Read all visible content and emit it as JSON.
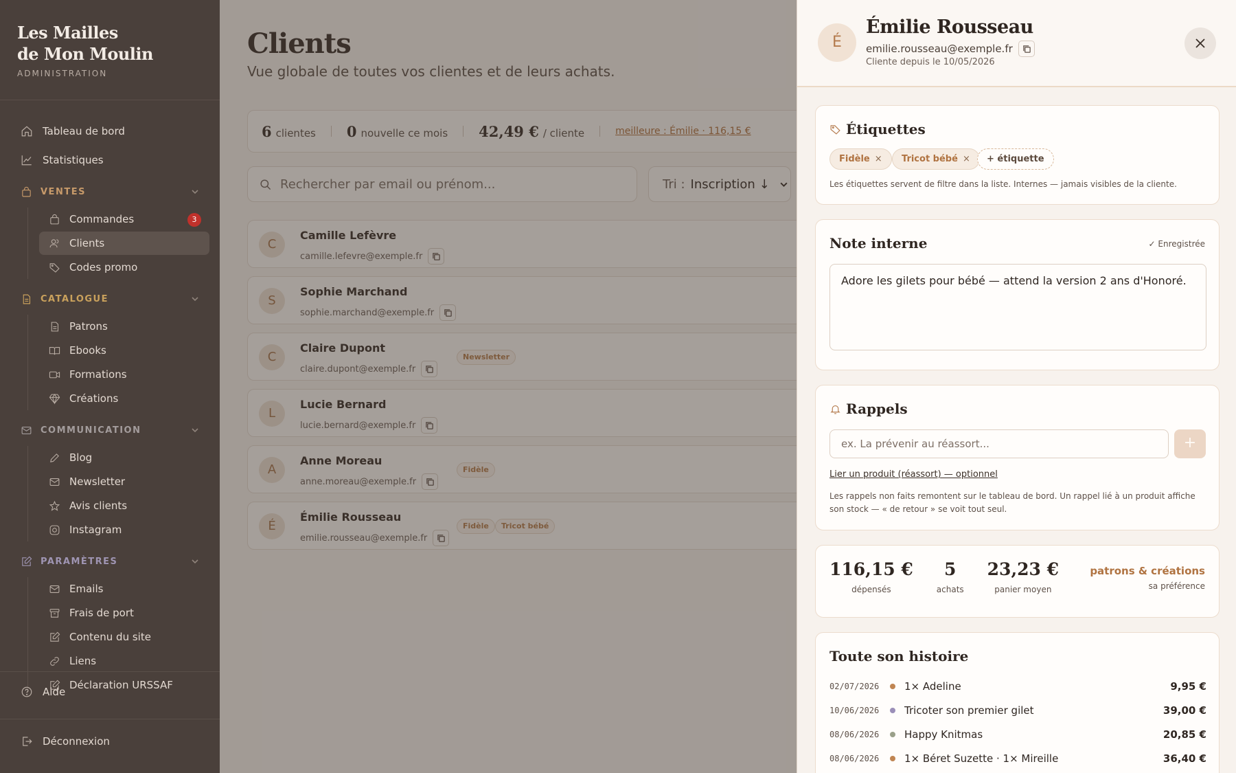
{
  "brand": {
    "line1": "Les Mailles",
    "line2": "de Mon Moulin",
    "subtitle": "ADMINISTRATION"
  },
  "nav": {
    "dashboard": "Tableau de bord",
    "stats": "Statistiques",
    "ventes": {
      "title": "VENTES",
      "items": [
        "Commandes",
        "Clients",
        "Codes promo"
      ],
      "orders_badge": "3"
    },
    "catalogue": {
      "title": "CATALOGUE",
      "items": [
        "Patrons",
        "Ebooks",
        "Formations",
        "Créations"
      ]
    },
    "communication": {
      "title": "COMMUNICATION",
      "items": [
        "Blog",
        "Newsletter",
        "Avis clients",
        "Instagram"
      ]
    },
    "parametres": {
      "title": "PARAMÈTRES",
      "items": [
        "Emails",
        "Frais de port",
        "Contenu du site",
        "Liens",
        "Déclaration URSSAF"
      ]
    },
    "help": "Aide",
    "logout": "Déconnexion"
  },
  "main": {
    "title": "Clients",
    "subtitle": "Vue globale de toutes vos clientes et de leurs achats.",
    "stats": {
      "count": "6",
      "count_label": "clientes",
      "new": "0",
      "new_label": "nouvelle ce mois",
      "avg": "42,49 €",
      "avg_label": "/ cliente",
      "best": "meilleure : Émilie · 116,15 €"
    },
    "search_placeholder": "Rechercher par email ou prénom...",
    "sort_label": "Tri :",
    "sort_value": "Inscription ↓",
    "clients": [
      {
        "initial": "C",
        "name": "Camille Lefèvre",
        "email": "camille.lefevre@exemple.fr",
        "tags": []
      },
      {
        "initial": "S",
        "name": "Sophie Marchand",
        "email": "sophie.marchand@exemple.fr",
        "tags": []
      },
      {
        "initial": "C",
        "name": "Claire Dupont",
        "email": "claire.dupont@exemple.fr",
        "tags": [
          "Newsletter"
        ]
      },
      {
        "initial": "L",
        "name": "Lucie Bernard",
        "email": "lucie.bernard@exemple.fr",
        "tags": []
      },
      {
        "initial": "A",
        "name": "Anne Moreau",
        "email": "anne.moreau@exemple.fr",
        "tags": [
          "Fidèle"
        ]
      },
      {
        "initial": "É",
        "name": "Émilie Rousseau",
        "email": "emilie.rousseau@exemple.fr",
        "tags": [
          "Fidèle",
          "Tricot bébé"
        ]
      }
    ]
  },
  "drawer": {
    "initial": "É",
    "name": "Émilie Rousseau",
    "email": "emilie.rousseau@exemple.fr",
    "since": "Cliente depuis le 10/05/2026",
    "tags_card": {
      "title": "Étiquettes",
      "tags": [
        "Fidèle",
        "Tricot bébé"
      ],
      "remove": "×",
      "add_label": "+ étiquette",
      "hint": "Les étiquettes servent de filtre dans la liste. Internes — jamais visibles de la cliente."
    },
    "note_card": {
      "title": "Note interne",
      "status": "✓ Enregistrée",
      "text": "Adore les gilets pour bébé — attend la version 2 ans d'Honoré."
    },
    "reminders_card": {
      "title": "Rappels",
      "placeholder": "ex. La prévenir au réassort...",
      "add": "+",
      "link_product": "Lier un produit (réassort) — optionnel",
      "hint": "Les rappels non faits remontent sur le tableau de bord. Un rappel lié à un produit affiche son stock — « de retour » se voit tout seul."
    },
    "totals": {
      "spent": "116,15 €",
      "spent_label": "dépensés",
      "count": "5",
      "count_label": "achats",
      "avg": "23,23 €",
      "avg_label": "panier moyen",
      "pref": "patrons & créations",
      "pref_label": "sa préférence"
    },
    "history": {
      "title": "Toute son histoire",
      "rows": [
        {
          "date": "02/07/2026",
          "label": "1× Adeline",
          "amount": "9,95 €",
          "color": "#c08552"
        },
        {
          "date": "10/06/2026",
          "label": "Tricoter son premier gilet",
          "amount": "39,00 €",
          "color": "#9b8fb8"
        },
        {
          "date": "08/06/2026",
          "label": "Happy Knitmas",
          "amount": "20,85 €",
          "color": "#9aa08a"
        },
        {
          "date": "08/06/2026",
          "label": "1× Béret Suzette · 1× Mireille",
          "amount": "36,40 €",
          "color": "#c08552"
        }
      ]
    }
  }
}
